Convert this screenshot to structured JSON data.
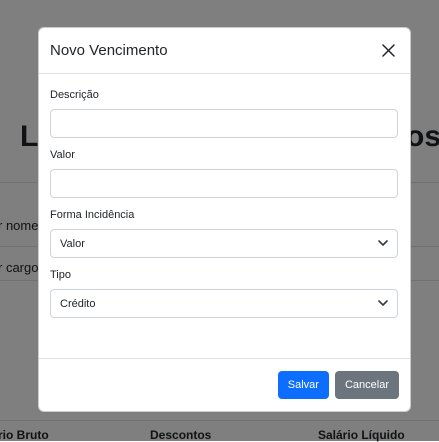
{
  "background": {
    "title_left": "Li",
    "title_right": "os",
    "filter_name_label": "r nome",
    "filter_role_label": "r cargo",
    "columns": [
      "rio Bruto",
      "Descontos",
      "Salário Líquido"
    ]
  },
  "modal": {
    "title": "Novo Vencimento",
    "close_icon": "close-icon",
    "fields": {
      "descricao": {
        "label": "Descrição",
        "value": "",
        "placeholder": ""
      },
      "valor": {
        "label": "Valor",
        "value": "",
        "placeholder": ""
      },
      "forma_incidencia": {
        "label": "Forma Incidência",
        "selected": "Valor"
      },
      "tipo": {
        "label": "Tipo",
        "selected": "Crédito"
      }
    },
    "buttons": {
      "save": "Salvar",
      "cancel": "Cancelar"
    }
  },
  "colors": {
    "primary": "#0d6efd",
    "secondary": "#6c757d",
    "backdrop": "rgba(0,0,0,0.5)"
  }
}
